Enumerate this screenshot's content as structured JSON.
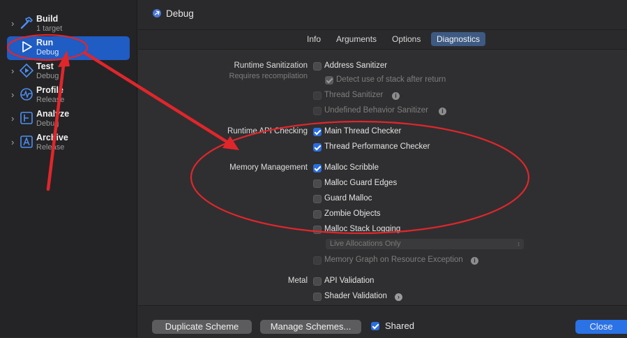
{
  "sidebar": {
    "items": [
      {
        "title": "Build",
        "subtitle": "1 target",
        "icon": "hammer-icon"
      },
      {
        "title": "Run",
        "subtitle": "Debug",
        "icon": "play-icon",
        "selected": true
      },
      {
        "title": "Test",
        "subtitle": "Debug",
        "icon": "test-diamond-icon"
      },
      {
        "title": "Profile",
        "subtitle": "Release",
        "icon": "instruments-gauge-icon"
      },
      {
        "title": "Analyze",
        "subtitle": "Debug",
        "icon": "analyze-icon"
      },
      {
        "title": "Archive",
        "subtitle": "Release",
        "icon": "archive-icon"
      }
    ]
  },
  "header": {
    "title": "Debug"
  },
  "tabs": [
    {
      "label": "Info"
    },
    {
      "label": "Arguments"
    },
    {
      "label": "Options"
    },
    {
      "label": "Diagnostics",
      "active": true
    }
  ],
  "diagnostics": {
    "runtime_sanitization": {
      "label": "Runtime Sanitization",
      "sublabel": "Requires recompilation",
      "address_sanitizer": {
        "label": "Address Sanitizer",
        "checked": false
      },
      "detect_stack": {
        "label": "Detect use of stack after return",
        "checked": true,
        "disabled": true
      },
      "thread_sanitizer": {
        "label": "Thread Sanitizer",
        "checked": false,
        "disabled": true
      },
      "ub_sanitizer": {
        "label": "Undefined Behavior Sanitizer",
        "checked": false,
        "disabled": true
      }
    },
    "runtime_api": {
      "label": "Runtime API Checking",
      "main_thread": {
        "label": "Main Thread Checker",
        "checked": true
      },
      "thread_perf": {
        "label": "Thread Performance Checker",
        "checked": true
      }
    },
    "memory": {
      "label": "Memory Management",
      "malloc_scribble": {
        "label": "Malloc Scribble",
        "checked": true
      },
      "malloc_guard": {
        "label": "Malloc Guard Edges",
        "checked": false
      },
      "guard_malloc": {
        "label": "Guard Malloc",
        "checked": false
      },
      "zombie": {
        "label": "Zombie Objects",
        "checked": false
      },
      "stack_logging": {
        "label": "Malloc Stack Logging",
        "checked": false
      },
      "alloc_select": {
        "value": "Live Allocations Only"
      },
      "memory_graph": {
        "label": "Memory Graph on Resource Exception",
        "checked": false,
        "disabled": true
      }
    },
    "metal": {
      "label": "Metal",
      "api_validation": {
        "label": "API Validation",
        "checked": false
      },
      "shader_validation": {
        "label": "Shader Validation",
        "checked": false
      }
    }
  },
  "footer": {
    "duplicate": "Duplicate Scheme",
    "manage": "Manage Schemes...",
    "shared": {
      "label": "Shared",
      "checked": true
    },
    "close": "Close"
  },
  "colors": {
    "accent": "#2a72e6",
    "selection": "#1f5cc4",
    "annotation": "#e0262b"
  }
}
